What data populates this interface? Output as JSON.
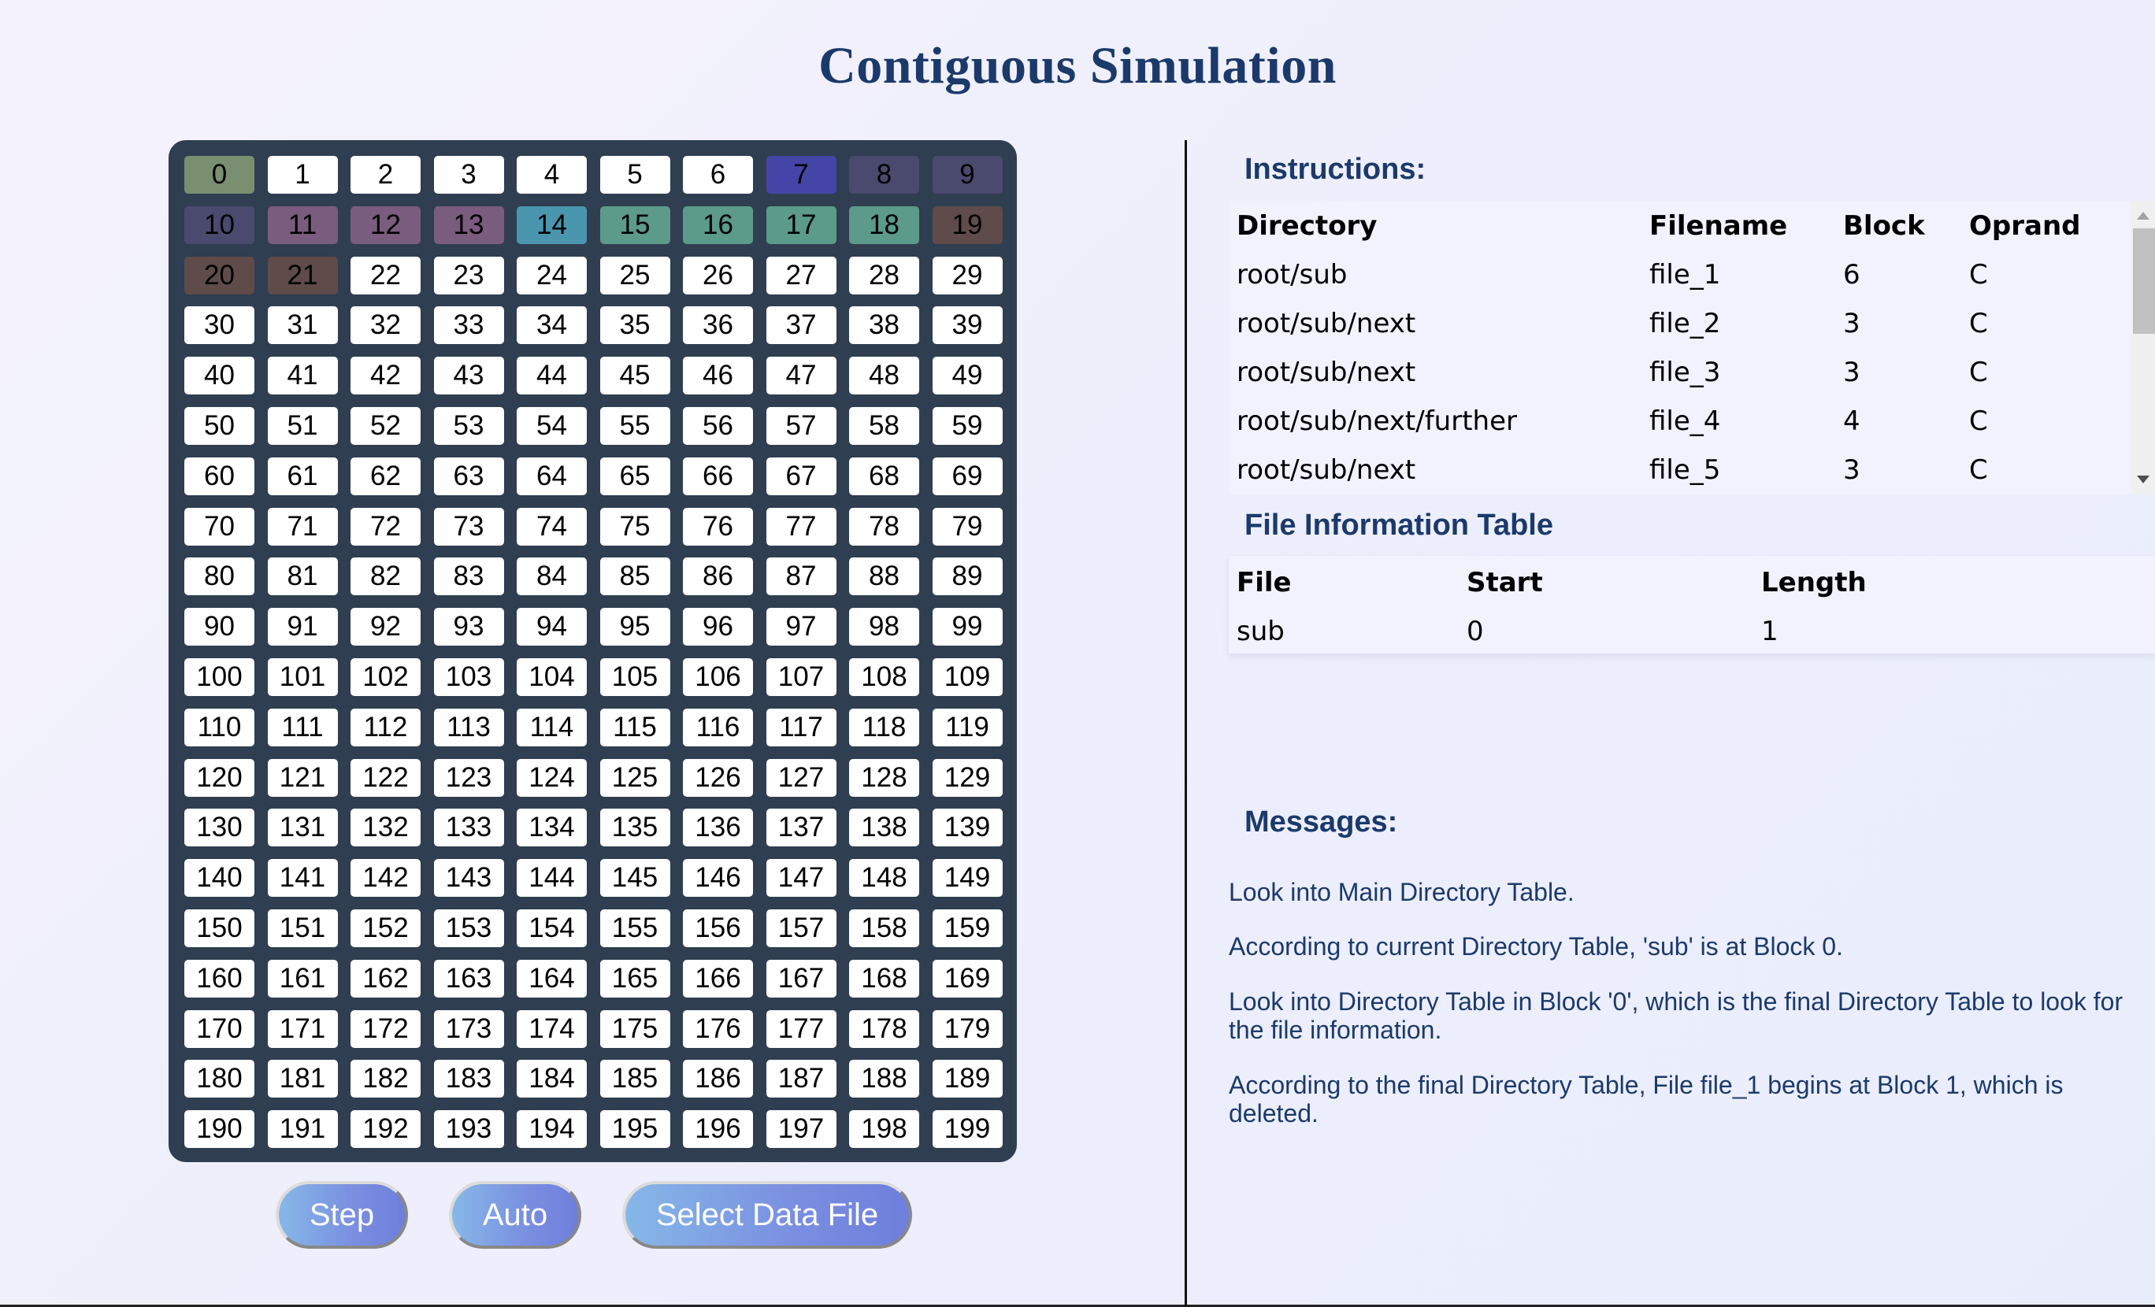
{
  "title": "Contiguous Simulation",
  "grid": {
    "background": "#2f3e50",
    "block_count": 200,
    "columns": 10,
    "default_color": "#ffffff",
    "colored_blocks": {
      "0": "#7a8e70",
      "7": "#4545a8",
      "8": "#4a4a6e",
      "9": "#4a4a6e",
      "10": "#4a4a6e",
      "11": "#7a5c7e",
      "12": "#7a5c7e",
      "13": "#7a5c7e",
      "14": "#4a96ae",
      "15": "#5c9a8a",
      "16": "#5c9a8a",
      "17": "#5c9a8a",
      "18": "#5c9a8a",
      "19": "#5e4b4a",
      "20": "#5e4b4a",
      "21": "#5e4b4a"
    }
  },
  "buttons": {
    "step": "Step",
    "auto": "Auto",
    "select_file": "Select Data File"
  },
  "instructions": {
    "heading": "Instructions:",
    "columns": [
      "Directory",
      "Filename",
      "Block",
      "Oprand"
    ],
    "rows": [
      [
        "root/sub",
        "file_1",
        "6",
        "C"
      ],
      [
        "root/sub/next",
        "file_2",
        "3",
        "C"
      ],
      [
        "root/sub/next",
        "file_3",
        "3",
        "C"
      ],
      [
        "root/sub/next/further",
        "file_4",
        "4",
        "C"
      ],
      [
        "root/sub/next",
        "file_5",
        "3",
        "C"
      ]
    ]
  },
  "file_info": {
    "heading": "File Information Table",
    "columns": [
      "File",
      "Start",
      "Length"
    ],
    "rows": [
      [
        "sub",
        "0",
        "1"
      ]
    ]
  },
  "messages": {
    "heading": "Messages:",
    "items": [
      "Look into Main Directory Table.",
      "According to current Directory Table, 'sub' is at Block 0.",
      "Look into Directory Table in Block '0', which is the final Directory Table to look for the file information.",
      "According to the final Directory Table, File file_1 begins at Block 1, which is deleted."
    ]
  }
}
